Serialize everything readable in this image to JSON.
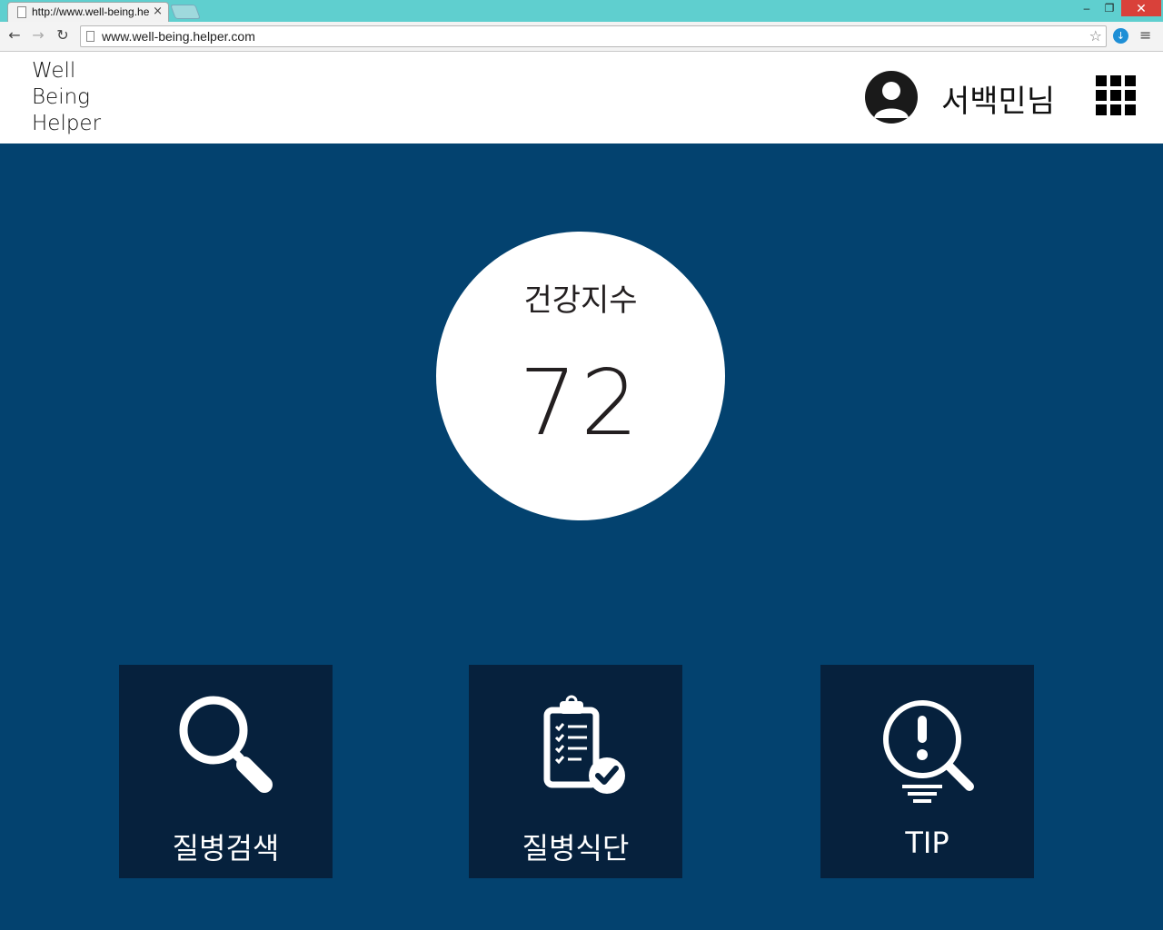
{
  "browser": {
    "tab_title": "http://www.well-being.he",
    "tab_close": "×",
    "url": "www.well-being.helper.com",
    "window_controls": {
      "minimize": "–",
      "maximize": "❐",
      "close": "✕"
    },
    "nav": {
      "back": "←",
      "forward": "→",
      "reload": "↻",
      "star": "☆",
      "menu": "≡",
      "ext": "↓"
    }
  },
  "header": {
    "logo": [
      "Well",
      "Being",
      "Helper"
    ],
    "username": "서백민님",
    "avatar_icon": "user-avatar-icon",
    "apps_icon": "apps-grid-icon"
  },
  "score": {
    "label": "건강지수",
    "value": "72"
  },
  "tiles": [
    {
      "label": "질병검색",
      "icon": "search-icon"
    },
    {
      "label": "질병식단",
      "icon": "clipboard-check-icon"
    },
    {
      "label": "TIP",
      "icon": "alert-search-icon"
    }
  ],
  "colors": {
    "background": "#03426f",
    "tile": "#06213d",
    "titlebar": "#5fcfcf",
    "circle": "#ffffff"
  }
}
